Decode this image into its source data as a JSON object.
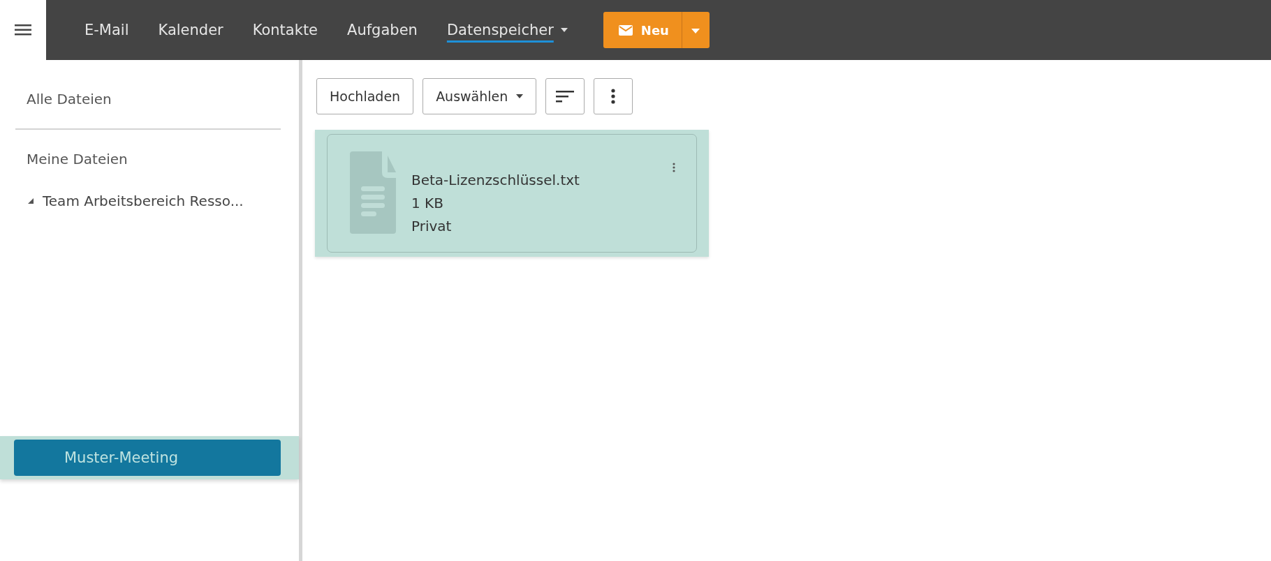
{
  "nav": {
    "tabs": [
      {
        "label": "E-Mail",
        "selected": false
      },
      {
        "label": "Kalender",
        "selected": false
      },
      {
        "label": "Kontakte",
        "selected": false
      },
      {
        "label": "Aufgaben",
        "selected": false
      },
      {
        "label": "Datenspeicher",
        "selected": true,
        "dropdown": true
      }
    ],
    "new_button": {
      "label": "Neu"
    }
  },
  "sidebar": {
    "items": [
      {
        "label": "Alle Dateien",
        "kind": "item"
      },
      {
        "label": "Meine Dateien",
        "kind": "item"
      },
      {
        "label": "Team Arbeitsbereich Resso...",
        "kind": "folder",
        "expanded": true
      }
    ],
    "dropped_item": {
      "label": "Muster-Meeting"
    }
  },
  "toolbar": {
    "upload": "Hochladen",
    "select": "Auswählen"
  },
  "files": [
    {
      "name": "Beta-Lizenzschlüssel.txt",
      "size": "1 KB",
      "visibility": "Privat",
      "selected": true
    }
  ]
}
